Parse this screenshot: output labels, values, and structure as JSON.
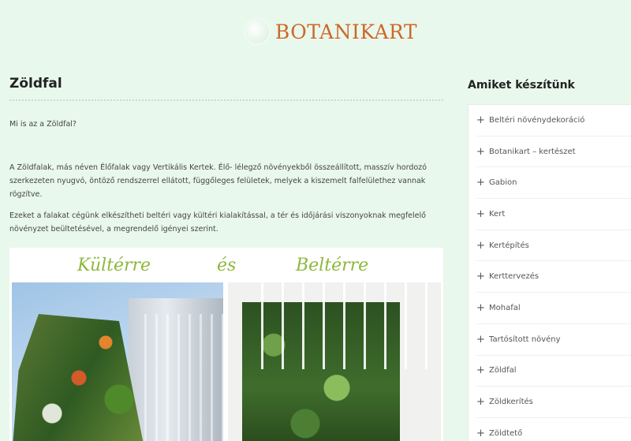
{
  "header": {
    "brand": "BOTANIKART",
    "logo_icon": "leaf-logo-icon"
  },
  "main": {
    "title": "Zöldfal",
    "intro": "Mi is az a Zöldfal?",
    "paragraph1": "A Zöldfalak, más néven Élőfalak vagy Vertikális Kertek. Élő- lélegző növényekből összeállított, masszív hordozó szerkezeten nyugvó, öntöző rendszerrel ellátott, függőleges felületek, melyek a kiszemelt falfelülethez vannak rögzítve.",
    "paragraph2": "Ezeket a falakat cégünk elkészítheti beltéri vagy kültéri kialakítással, a tér és időjárási viszonyoknak megfelelő növényzet beültetésével, a megrendelő igényei szerint.",
    "banner": {
      "left": "Kültérre",
      "middle": "és",
      "right": "Beltérre"
    }
  },
  "sidebar": {
    "title": "Amiket készítünk",
    "items": [
      {
        "label": "Beltéri növénydekoráció"
      },
      {
        "label": "Botanikart – kertészet"
      },
      {
        "label": "Gabion"
      },
      {
        "label": "Kert"
      },
      {
        "label": "Kertépítés"
      },
      {
        "label": "Kerttervezés"
      },
      {
        "label": "Mohafal"
      },
      {
        "label": "Tartósított növény"
      },
      {
        "label": "Zöldfal"
      },
      {
        "label": "Zöldkerítés"
      },
      {
        "label": "Zöldtető"
      }
    ]
  }
}
